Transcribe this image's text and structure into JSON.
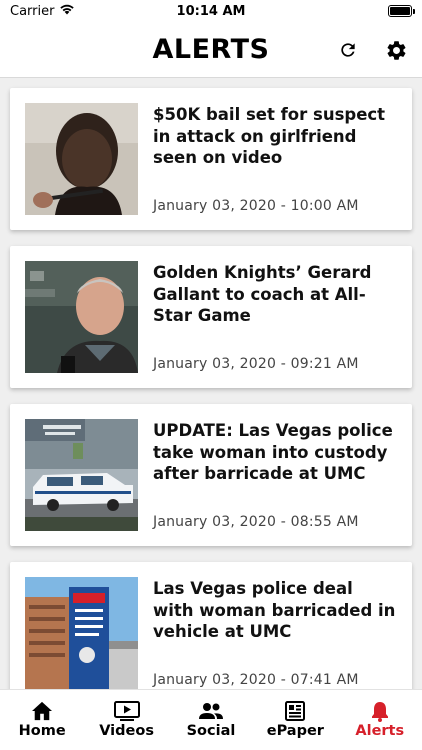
{
  "status_bar": {
    "carrier": "Carrier",
    "time": "10:14 AM"
  },
  "header": {
    "title": "ALERTS",
    "refresh_icon": "refresh-icon",
    "settings_icon": "gear-icon"
  },
  "alerts": [
    {
      "headline": "$50K bail set for suspect in attack on girlfriend seen on video",
      "date": "January 03, 2020 - 10:00 AM",
      "thumb": "mugshot photo"
    },
    {
      "headline": "Golden Knights’ Gerard Gallant to coach at All-Star Game",
      "date": "January 03, 2020 - 09:21 AM",
      "thumb": "coach photo"
    },
    {
      "headline": "UPDATE: Las Vegas police take woman into custody after barricade at UMC",
      "date": "January 03, 2020 - 08:55 AM",
      "thumb": "hospital police car photo"
    },
    {
      "headline": "Las Vegas police deal with woman barricaded in vehicle at UMC",
      "date": "January 03, 2020 - 07:41 AM",
      "thumb": "hospital building photo"
    }
  ],
  "tabs": [
    {
      "label": "Home",
      "icon": "home-icon",
      "active": false
    },
    {
      "label": "Videos",
      "icon": "video-icon",
      "active": false
    },
    {
      "label": "Social",
      "icon": "people-icon",
      "active": false
    },
    {
      "label": "ePaper",
      "icon": "newspaper-icon",
      "active": false
    },
    {
      "label": "Alerts",
      "icon": "bell-icon",
      "active": true
    }
  ],
  "colors": {
    "accent": "#d6202a",
    "background": "#efefef",
    "card": "#ffffff"
  }
}
